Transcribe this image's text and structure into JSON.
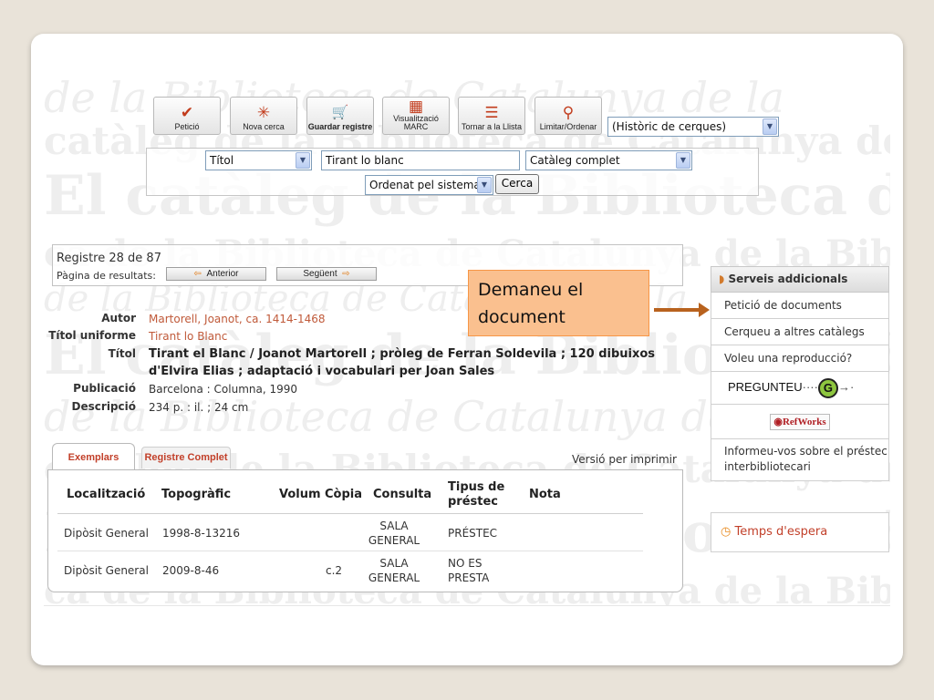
{
  "toolbar": {
    "buttons": [
      {
        "label": "Petició",
        "icon": "checkmark-icon",
        "glyph": "✔"
      },
      {
        "label": "Nova cerca",
        "icon": "sparkle-icon",
        "glyph": "✳"
      },
      {
        "label": "Guardar registre",
        "icon": "cart-icon",
        "glyph": "🛒"
      },
      {
        "label": "Visualització\nMARC",
        "icon": "grid-icon",
        "glyph": "▦"
      },
      {
        "label": "Tornar a la Llista",
        "icon": "list-icon",
        "glyph": "☰"
      },
      {
        "label": "Limitar/Ordenar",
        "icon": "magnifier-icon",
        "glyph": "⚲"
      }
    ],
    "history_select": "(Històric de cerques)"
  },
  "search": {
    "field_select": "Títol",
    "query": "Tirant lo blanc",
    "catalog_select": "Catàleg complet",
    "sort_select": "Ordenat pel sistema",
    "submit_label": "Cerca"
  },
  "record_nav": {
    "record_text": "Registre 28 de 87",
    "results_page_label": "Pàgina de resultats:",
    "prev_label": "Anterior",
    "next_label": "Següent"
  },
  "callout": {
    "text": "Demaneu el document",
    "color": "#fac08f"
  },
  "record": {
    "author_label": "Autor",
    "author": "Martorell, Joanot, ca. 1414-1468",
    "uniform_title_label": "Títol uniforme",
    "uniform_title": "Tirant lo Blanc",
    "title_label": "Títol",
    "title_line1": "Tirant el Blanc / Joanot Martorell ; pròleg de Ferran Soldevila ; 120 dibuixos",
    "title_line2": "d'Elvira Elias ; adaptació i vocabulari per Joan Sales",
    "publication_label": "Publicació",
    "publication": "Barcelona : Columna, 1990",
    "description_label": "Descripció",
    "description": "234 p. : il. ; 24 cm"
  },
  "sidebar": {
    "header": "Serveis addicionals",
    "items": [
      "Petició de documents",
      "Cerqueu a altres catàlegs",
      "Voleu una reproducció?"
    ],
    "pregunteu": "PREGUNTEU",
    "refworks": "RefWorks",
    "interlibrary": "Informeu-vos sobre el préstec interbibliotecari",
    "wait_time": "Temps d'espera"
  },
  "holdings": {
    "tabs": [
      "Exemplars",
      "Registre Complet"
    ],
    "print_link": "Versió per imprimir",
    "columns": [
      "Localització",
      "Topogràfic",
      "Volum",
      "Còpia",
      "Consulta",
      "Tipus de préstec",
      "Nota"
    ],
    "rows": [
      {
        "location": "Dipòsit General",
        "call_number": "1998-8-13216",
        "volume": "",
        "copy": "",
        "consult": "SALA GENERAL",
        "loan_type": "PRÉSTEC",
        "note": ""
      },
      {
        "location": "Dipòsit General",
        "call_number": "2009-8-46",
        "volume": "",
        "copy": "c.2",
        "consult": "SALA GENERAL",
        "loan_type": "NO ES PRESTA",
        "note": ""
      }
    ]
  },
  "watermark": {
    "line1": "de la Biblioteca de Catalunya de la",
    "line2": "catàleg de la Biblioteca de Catalunya de",
    "line3": "El catàleg de la Biblioteca de Catalunya El catàleg",
    "line4": "ca de la Biblioteca de Catalunya de la Biblioteca"
  }
}
